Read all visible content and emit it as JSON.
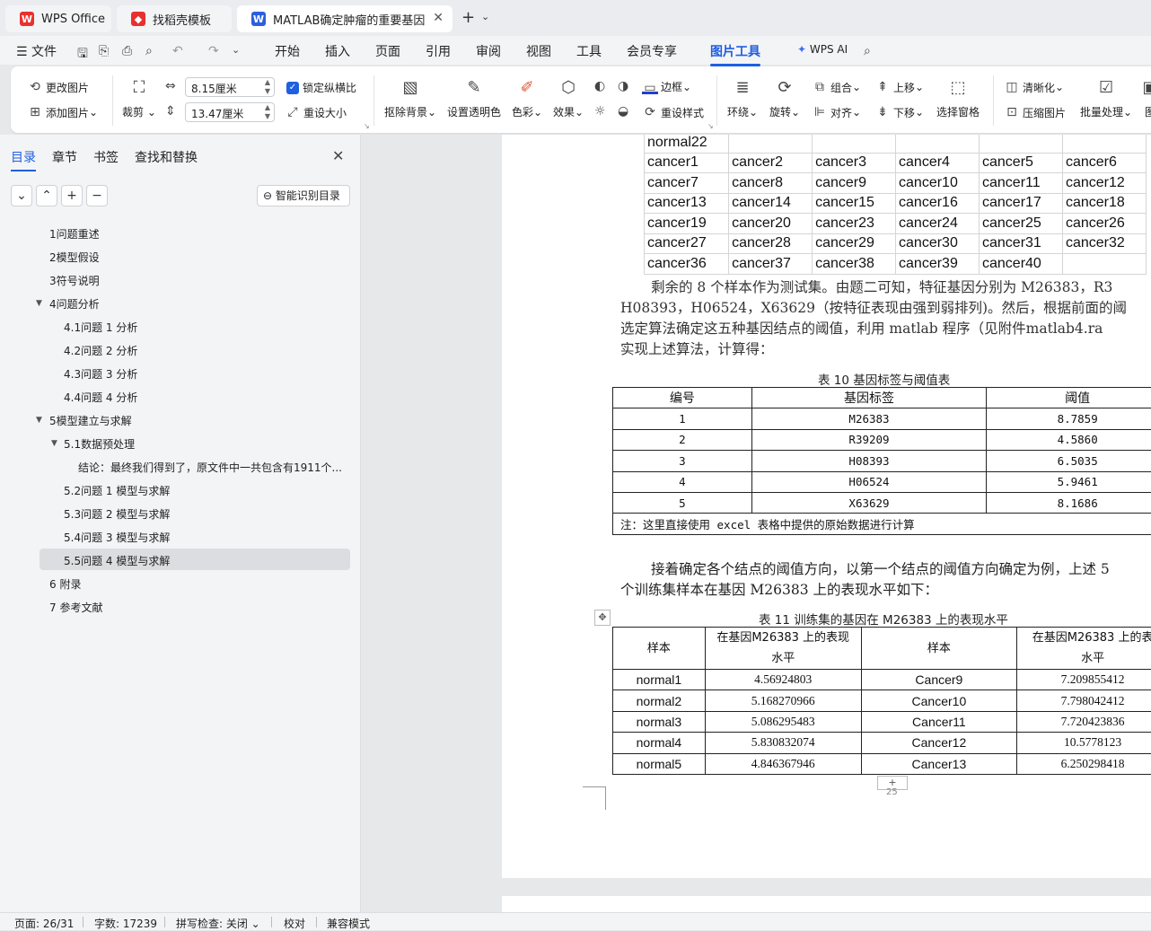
{
  "tabs": {
    "wps": "WPS Office",
    "template": "找稻壳模板",
    "doc": "MATLAB确定肿瘤的重要基因"
  },
  "menu": {
    "file": "文件",
    "items": [
      "开始",
      "插入",
      "页面",
      "引用",
      "审阅",
      "视图",
      "工具",
      "会员专享",
      "图片工具"
    ],
    "wps_ai": "WPS AI"
  },
  "ribbon": {
    "change_pic": "更改图片",
    "add_pic": "添加图片",
    "crop": "裁剪",
    "width": "8.15厘米",
    "height": "13.47厘米",
    "lock_ratio": "锁定纵横比",
    "reset_size": "重设大小",
    "remove_bg": "抠除背景",
    "set_transparent": "设置透明色",
    "color": "色彩",
    "effect": "效果",
    "border": "边框",
    "reset_style": "重设样式",
    "wrap": "环绕",
    "rotate": "旋转",
    "group": "组合",
    "align": "对齐",
    "move_up": "上移",
    "move_down": "下移",
    "select_pane": "选择窗格",
    "sharpen": "清晰化",
    "compress": "压缩图片",
    "batch": "批量处理",
    "more": "图"
  },
  "left_pane": {
    "tabs": [
      "目录",
      "章节",
      "书签",
      "查找和替换"
    ],
    "smart_toc": "智能识别目录",
    "toc": [
      "1问题重述",
      "2模型假设",
      "3符号说明",
      "4问题分析",
      "4.1问题 1 分析",
      "4.2问题 2 分析",
      "4.3问题 3 分析",
      "4.4问题 4 分析",
      "5模型建立与求解",
      "5.1数据预处理",
      "结论：最终我们得到了，原文件中一共包含有1911个...",
      "5.2问题 1 模型与求解",
      "5.3问题 2 模型与求解",
      "5.4问题 3 模型与求解",
      "5.5问题 4 模型与求解",
      "6 附录",
      "7 参考文献"
    ]
  },
  "doc": {
    "table9": [
      [
        "normal22",
        "",
        "",
        "",
        "",
        ""
      ],
      [
        "cancer1",
        "cancer2",
        "cancer3",
        "cancer4",
        "cancer5",
        "cancer6"
      ],
      [
        "cancer7",
        "cancer8",
        "cancer9",
        "cancer10",
        "cancer11",
        "cancer12"
      ],
      [
        "cancer13",
        "cancer14",
        "cancer15",
        "cancer16",
        "cancer17",
        "cancer18"
      ],
      [
        "cancer19",
        "cancer20",
        "cancer23",
        "cancer24",
        "cancer25",
        "cancer26"
      ],
      [
        "cancer27",
        "cancer28",
        "cancer29",
        "cancer30",
        "cancer31",
        "cancer32"
      ],
      [
        "cancer36",
        "cancer37",
        "cancer38",
        "cancer39",
        "cancer40",
        ""
      ]
    ],
    "para1": [
      "剩余的 8 个样本作为测试集。由题二可知，特征基因分别为 M26383，R3",
      "H08393，H06524，X63629（按特征表现由强到弱排列)。然后，根据前面的阈",
      "选定算法确定这五种基因结点的阈值，利用 matlab 程序（见附件matlab4.ra",
      "实现上述算法，计算得："
    ],
    "table10_caption": "表 10 基因标签与阈值表",
    "table10_header": [
      "编号",
      "基因标签",
      "阈值"
    ],
    "table10_rows": [
      [
        "1",
        "M26383",
        "8.7859"
      ],
      [
        "2",
        "R39209",
        "4.5860"
      ],
      [
        "3",
        "H08393",
        "6.5035"
      ],
      [
        "4",
        "H06524",
        "5.9461"
      ],
      [
        "5",
        "X63629",
        "8.1686"
      ]
    ],
    "table10_note": "注：这里直接使用 excel 表格中提供的原始数据进行计算",
    "para2": [
      "接着确定各个结点的阈值方向，以第一个结点的阈值方向确定为例，上述 5",
      "个训练集样本在基因 M26383 上的表现水平如下："
    ],
    "table11_caption": "表 11  训练集的基因在 M26383 上的表现水平",
    "table11_header": [
      "样本",
      "在基因M26383 上的表现\n水平",
      "样本",
      "在基因M26383 上的表\n水平"
    ],
    "table11_rows": [
      [
        "normal1",
        "4.56924803",
        "Cancer9",
        "7.209855412"
      ],
      [
        "normal2",
        "5.168270966",
        "Cancer10",
        "7.798042412"
      ],
      [
        "normal3",
        "5.086295483",
        "Cancer11",
        "7.720423836"
      ],
      [
        "normal4",
        "5.830832074",
        "Cancer12",
        "10.5778123"
      ],
      [
        "normal5",
        "4.846367946",
        "Cancer13",
        "6.250298418"
      ]
    ],
    "page_number": "25"
  },
  "status": {
    "page": "页面: 26/31",
    "words": "字数: 17239",
    "spell": "拼写检查: 关闭",
    "proof": "校对",
    "compat": "兼容模式"
  }
}
